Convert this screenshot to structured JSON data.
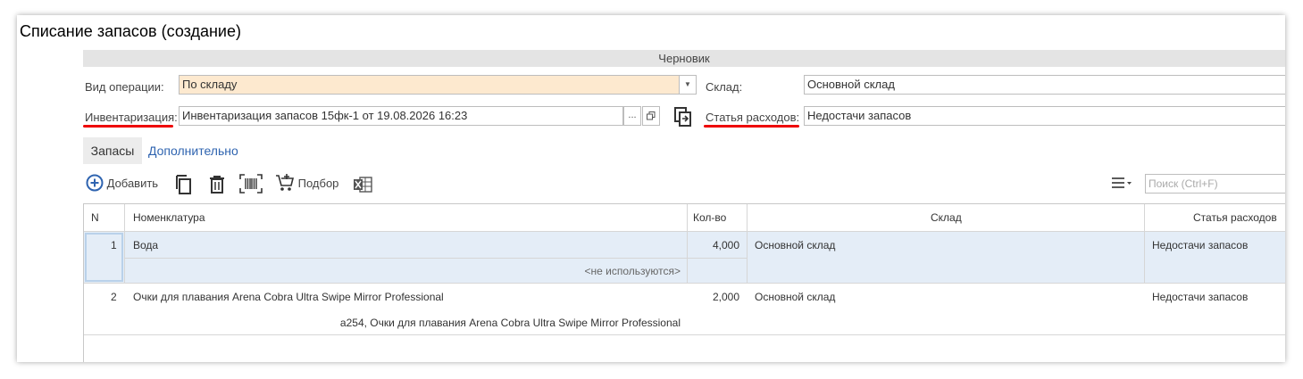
{
  "window": {
    "title": "Списание запасов (создание)"
  },
  "status": {
    "text": "Черновик"
  },
  "form": {
    "operation_label": "Вид операции:",
    "operation_value": "По складу",
    "warehouse_label": "Склад:",
    "warehouse_value": "Основной склад",
    "inventory_label": "Инвентаризация:",
    "inventory_value": "Инвентаризация запасов 15фк-1 от 19.08.2026 16:23",
    "expense_label": "Статья расходов:",
    "expense_value": "Недостачи запасов",
    "dots": "..."
  },
  "tabs": [
    {
      "label": "Запасы"
    },
    {
      "label": "Дополнительно"
    }
  ],
  "toolbar": {
    "add_label": "Добавить",
    "pick_label": "Подбор",
    "search_placeholder": "Поиск (Ctrl+F)"
  },
  "table": {
    "headers": {
      "n": "N",
      "item": "Номенклатура",
      "qty": "Кол-во",
      "warehouse": "Склад",
      "expense": "Статья расходов"
    },
    "rows": [
      {
        "n": "1",
        "item": "Вода",
        "sub": "<не используются>",
        "qty": "4,000",
        "warehouse": "Основной склад",
        "expense": "Недостачи запасов"
      },
      {
        "n": "2",
        "item": "Очки для плавания Arena Cobra Ultra Swipe Mirror Professional",
        "sub": "а254, Очки для плавания Arena Cobra Ultra Swipe Mirror Professional",
        "qty": "2,000",
        "warehouse": "Основной склад",
        "expense": "Недостачи запасов"
      }
    ]
  },
  "colors": {
    "accent": "#2f64b0",
    "highlight": "#fde9cf",
    "selection": "#e4edf7",
    "underline": "#ee0000"
  }
}
